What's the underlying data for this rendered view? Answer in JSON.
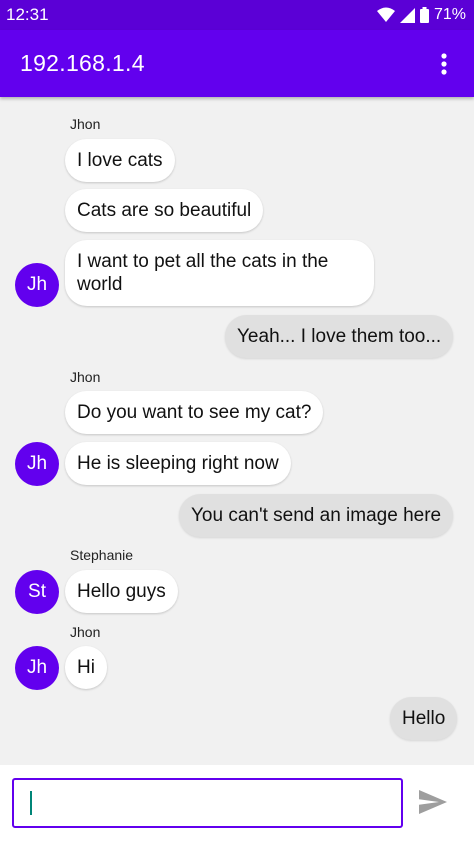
{
  "status_bar": {
    "time": "12:31",
    "battery": "71%"
  },
  "app_bar": {
    "title": "192.168.1.4",
    "menu_icon": "more-vert-icon"
  },
  "messages": [
    {
      "sender": "Jhon",
      "text": "I love cats"
    },
    {
      "text": "Cats are so beautiful"
    },
    {
      "text": "I want to pet all the cats in the world",
      "avatar": "Jh"
    },
    {
      "text": "Yeah... I love them too..."
    },
    {
      "sender": "Jhon",
      "text": "Do you want to see my cat?"
    },
    {
      "text": "He is sleeping right now",
      "avatar": "Jh"
    },
    {
      "text": "You can't send an image here"
    },
    {
      "sender": "Stephanie",
      "text": "Hello guys",
      "avatar": "St"
    },
    {
      "sender": "Jhon",
      "text": "Hi",
      "avatar": "Jh"
    },
    {
      "text": "Hello"
    }
  ],
  "composer": {
    "value": "",
    "placeholder": "",
    "send_icon": "send-icon"
  },
  "colors": {
    "primary": "#6200ee",
    "status_bar": "#5b00d6",
    "incoming_bubble": "#ffffff",
    "outgoing_bubble": "#e0e0e0",
    "background": "#f1f1f1"
  }
}
